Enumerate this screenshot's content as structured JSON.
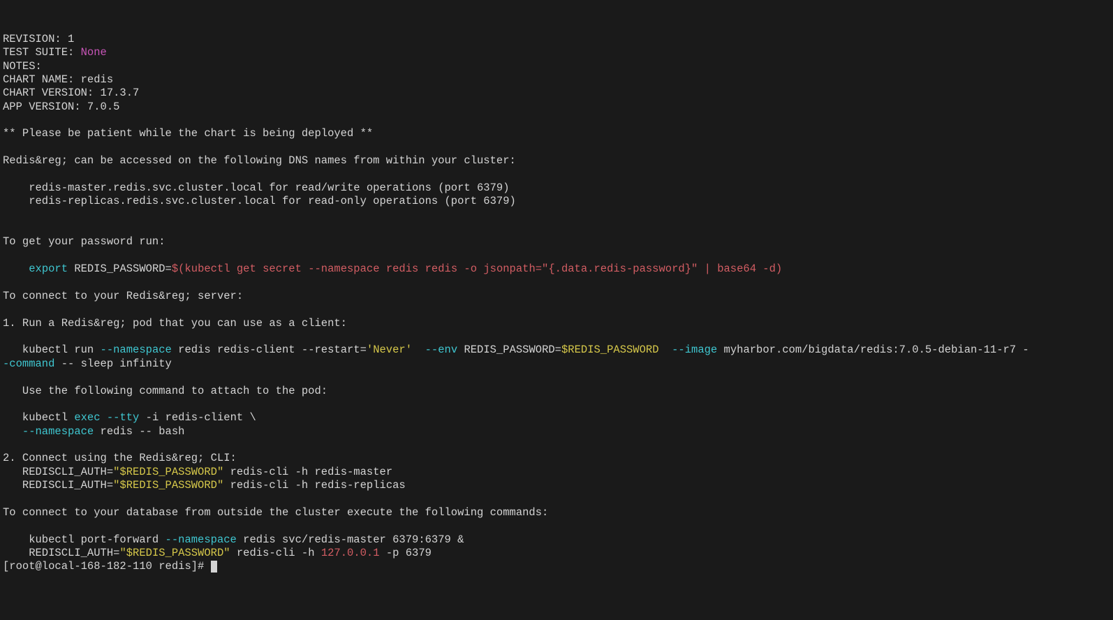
{
  "header": {
    "revision_label": "REVISION: ",
    "revision_value": "1",
    "test_suite_label": "TEST SUITE: ",
    "test_suite_value": "None",
    "notes_label": "NOTES:",
    "chart_name_label": "CHART NAME: ",
    "chart_name_value": "redis",
    "chart_version_label": "CHART VERSION: ",
    "chart_version_value": "17.3.7",
    "app_version_label": "APP VERSION: ",
    "app_version_value": "7.0.5"
  },
  "body": {
    "deploy_msg": "** Please be patient while the chart is being deployed **",
    "access_intro": "Redis&reg; can be accessed on the following DNS names from within your cluster:",
    "dns_master": "    redis-master.redis.svc.cluster.local for read/write operations (port 6379)",
    "dns_replicas": "    redis-replicas.redis.svc.cluster.local for read-only operations (port 6379)",
    "get_password_intro": "To get your password run:",
    "export_cmd_prefix": "    ",
    "export_kw": "export",
    "export_var": " REDIS_PASSWORD=",
    "export_subshell_open": "$(",
    "export_subshell_body": "kubectl get secret --namespace redis redis -o jsonpath=\"{.data.redis-password}\" | base64 -d)",
    "connect_intro": "To connect to your Redis&reg; server:",
    "step1_intro": "1. Run a Redis&reg; pod that you can use as a client:",
    "step1_cmd_prefix": "   kubectl run ",
    "step1_ns_flag": "--namespace",
    "step1_after_ns": " redis redis-client --restart=",
    "step1_never": "'Never'",
    "step1_env_flag": "  --env",
    "step1_env_var": " REDIS_PASSWORD=",
    "step1_env_val": "$REDIS_PASSWORD",
    "step1_image_flag": "  --image",
    "step1_image_val": " myharbor.com/bigdata/redis:7.0.5-debian-11-r7 -",
    "step1_line2": "-command",
    "step1_line2_after": " -- sleep infinity",
    "attach_intro": "   Use the following command to attach to the pod:",
    "attach_cmd1_prefix": "   kubectl ",
    "attach_exec": "exec",
    "attach_tty": " --tty",
    "attach_rest1": " -i redis-client \\",
    "attach_cmd2_prefix": "   ",
    "attach_ns_flag": "--namespace",
    "attach_rest2": " redis -- bash",
    "step2_intro": "2. Connect using the Redis&reg; CLI:",
    "step2_line1_prefix": "   REDISCLI_AUTH=",
    "step2_line1_var": "\"$REDIS_PASSWORD\"",
    "step2_line1_rest": " redis-cli -h redis-master",
    "step2_line2_prefix": "   REDISCLI_AUTH=",
    "step2_line2_var": "\"$REDIS_PASSWORD\"",
    "step2_line2_rest": " redis-cli -h redis-replicas",
    "outside_intro": "To connect to your database from outside the cluster execute the following commands:",
    "pf_prefix": "    kubectl port-forward ",
    "pf_ns_flag": "--namespace",
    "pf_rest": " redis svc/redis-master 6379:6379 &",
    "out_line2_prefix": "    REDISCLI_AUTH=",
    "out_line2_var": "\"$REDIS_PASSWORD\"",
    "out_line2_mid": " redis-cli -h ",
    "out_line2_ip": "127.0.0.1",
    "out_line2_port": " -p 6379"
  },
  "prompt": {
    "text": "[root@local-168-182-110 redis]# "
  }
}
